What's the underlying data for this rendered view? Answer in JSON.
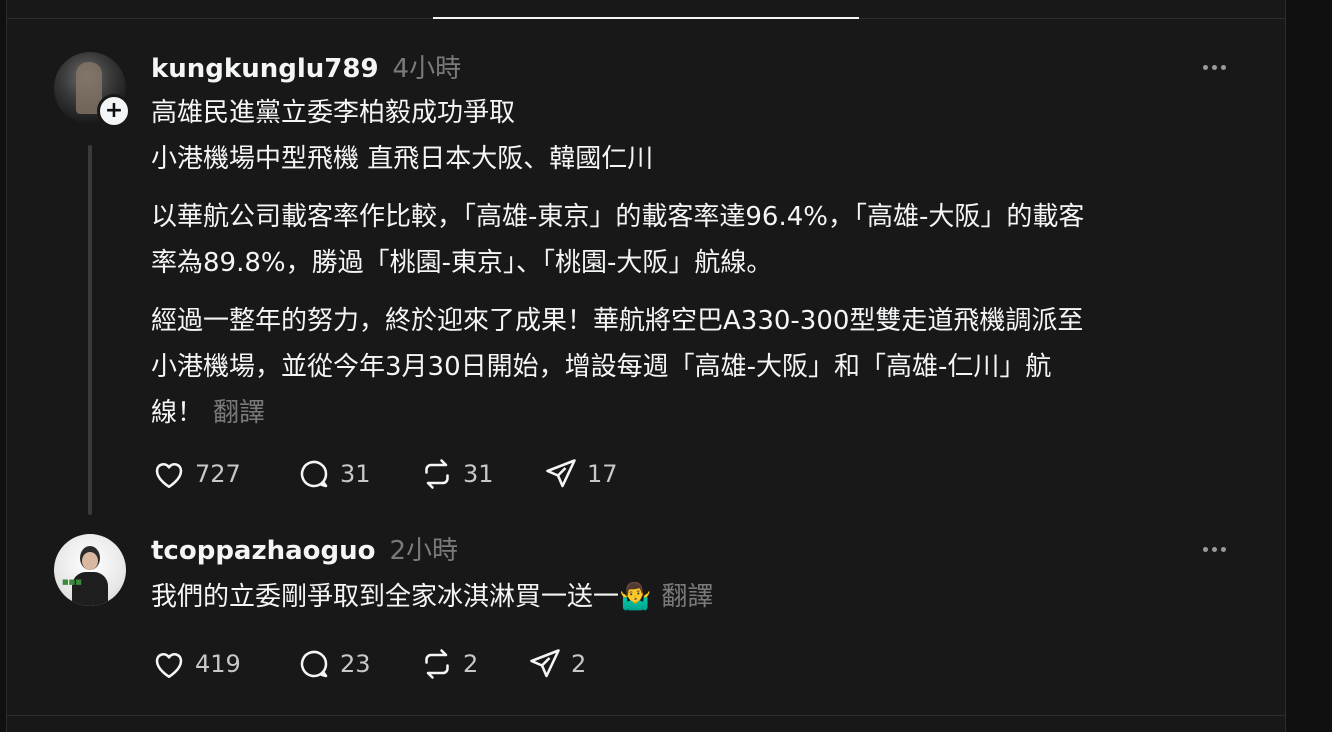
{
  "posts": [
    {
      "username": "kungkunglu789",
      "time": "4小時",
      "text": "高雄民進黨立委李柏毅成功爭取\n小港機場中型飛機 直飛日本大阪、韓國仁川",
      "text2": "以華航公司載客率作比較，「高雄-東京」的載客率達96.4%，「高雄-大阪」的載客\n率為89.8%，勝過「桃園-東京」、「桃園-大阪」航線。",
      "text3": "經過一整年的努力，終於迎來了成果！華航將空巴A330-300型雙走道飛機調派至\n小港機場，並從今年3月30日開始，增設每週「高雄-大阪」和「高雄-仁川」航\n線！",
      "translate": "翻譯",
      "likes": "727",
      "replies": "31",
      "reposts": "31",
      "shares": "17"
    },
    {
      "username": "tcoppazhaoguo",
      "time": "2小時",
      "text": "我們的立委剛爭取到全家冰淇淋買一送一🤷‍♂️",
      "translate": "翻譯",
      "likes": "419",
      "replies": "23",
      "reposts": "2",
      "shares": "2"
    }
  ],
  "icons": {
    "like": "heart-icon",
    "reply": "comment-icon",
    "repost": "repost-icon",
    "share": "send-icon",
    "more": "more-icon",
    "follow": "plus-icon"
  }
}
